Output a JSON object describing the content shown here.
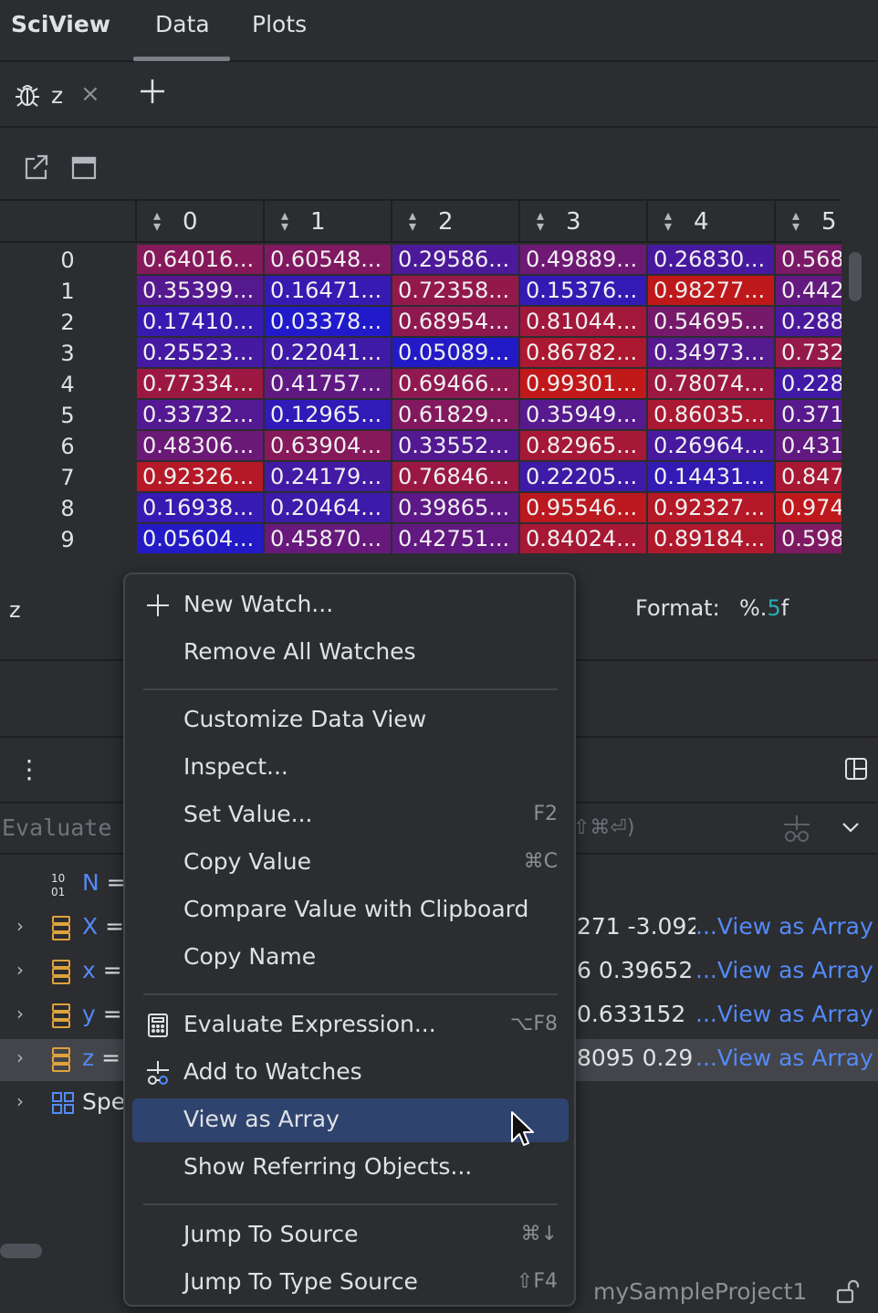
{
  "header": {
    "app_title": "SciView",
    "tabs": [
      {
        "label": "Data",
        "active": true
      },
      {
        "label": "Plots",
        "active": false
      }
    ]
  },
  "watch_tabs": {
    "current": "z"
  },
  "grid": {
    "columns": [
      "0",
      "1",
      "2",
      "3",
      "4",
      "5"
    ],
    "rows": [
      {
        "index": "0",
        "cells": [
          "0.64016...",
          "0.60548...",
          "0.29586...",
          "0.49889...",
          "0.26830...",
          "0.568"
        ]
      },
      {
        "index": "1",
        "cells": [
          "0.35399...",
          "0.16471...",
          "0.72358...",
          "0.15376...",
          "0.98277...",
          "0.442"
        ]
      },
      {
        "index": "2",
        "cells": [
          "0.17410...",
          "0.03378...",
          "0.68954...",
          "0.81044...",
          "0.54695...",
          "0.288"
        ]
      },
      {
        "index": "3",
        "cells": [
          "0.25523...",
          "0.22041...",
          "0.05089...",
          "0.86782...",
          "0.34973...",
          "0.732"
        ]
      },
      {
        "index": "4",
        "cells": [
          "0.77334...",
          "0.41757...",
          "0.69466...",
          "0.99301...",
          "0.78074...",
          "0.228"
        ]
      },
      {
        "index": "5",
        "cells": [
          "0.33732...",
          "0.12965...",
          "0.61829...",
          "0.35949...",
          "0.86035...",
          "0.371"
        ]
      },
      {
        "index": "6",
        "cells": [
          "0.48306...",
          "0.63904...",
          "0.33552...",
          "0.82965...",
          "0.26964...",
          "0.431"
        ]
      },
      {
        "index": "7",
        "cells": [
          "0.92326...",
          "0.24179...",
          "0.76846...",
          "0.22205...",
          "0.14431...",
          "0.847"
        ]
      },
      {
        "index": "8",
        "cells": [
          "0.16938...",
          "0.20464...",
          "0.39865...",
          "0.95546...",
          "0.92327...",
          "0.974"
        ]
      },
      {
        "index": "9",
        "cells": [
          "0.05604...",
          "0.45870...",
          "0.42751...",
          "0.84024...",
          "0.89184...",
          "0.598"
        ]
      }
    ],
    "heat_values": [
      [
        0.64016,
        0.60548,
        0.29586,
        0.49889,
        0.2683,
        0.568
      ],
      [
        0.35399,
        0.16471,
        0.72358,
        0.15376,
        0.98277,
        0.442
      ],
      [
        0.1741,
        0.03378,
        0.68954,
        0.81044,
        0.54695,
        0.288
      ],
      [
        0.25523,
        0.22041,
        0.05089,
        0.86782,
        0.34973,
        0.732
      ],
      [
        0.77334,
        0.41757,
        0.69466,
        0.99301,
        0.78074,
        0.228
      ],
      [
        0.33732,
        0.12965,
        0.61829,
        0.35949,
        0.86035,
        0.371
      ],
      [
        0.48306,
        0.63904,
        0.33552,
        0.82965,
        0.26964,
        0.431
      ],
      [
        0.92326,
        0.24179,
        0.76846,
        0.22205,
        0.14431,
        0.847
      ],
      [
        0.16938,
        0.20464,
        0.39865,
        0.95546,
        0.92327,
        0.974
      ],
      [
        0.05604,
        0.4587,
        0.42751,
        0.84024,
        0.89184,
        0.598
      ]
    ]
  },
  "format_bar": {
    "variable": "z",
    "label": "Format:",
    "value_prefix": "%.",
    "value_digit": "5",
    "value_suffix": "f"
  },
  "evaluate": {
    "placeholder": "Evaluate",
    "hint": "⇧⌘⏎)"
  },
  "variables": [
    {
      "name": "N",
      "eq": " =",
      "value": "",
      "link": "",
      "icon": "number-icon",
      "expandable": false
    },
    {
      "name": "X",
      "eq": " =",
      "value": "271 -3.092",
      "link": "...View as Array",
      "icon": "array-icon",
      "expandable": true
    },
    {
      "name": "x",
      "eq": " =",
      "value": "6 0.39652",
      "link": "...View as Array",
      "icon": "array-icon",
      "expandable": true
    },
    {
      "name": "y",
      "eq": " =",
      "value": "0.633152",
      "link": "...View as Array",
      "icon": "array-icon",
      "expandable": true
    },
    {
      "name": "z",
      "eq": " =",
      "value": "8095 0.29",
      "link": "...View as Array",
      "icon": "array-icon",
      "expandable": true,
      "selected": true
    },
    {
      "name": "Spe",
      "eq": "",
      "value": "",
      "link": "",
      "icon": "special-vars-icon",
      "expandable": true
    }
  ],
  "status": {
    "project": "mySampleProject1"
  },
  "context_menu": {
    "items": [
      {
        "label": "New Watch...",
        "shortcut": "",
        "icon": "plus-icon"
      },
      {
        "label": "Remove All Watches",
        "shortcut": ""
      },
      {
        "separator": true
      },
      {
        "label": "Customize Data View",
        "shortcut": ""
      },
      {
        "label": "Inspect...",
        "shortcut": ""
      },
      {
        "label": "Set Value...",
        "shortcut": "F2"
      },
      {
        "label": "Copy Value",
        "shortcut": "⌘C"
      },
      {
        "label": "Compare Value with Clipboard",
        "shortcut": ""
      },
      {
        "label": "Copy Name",
        "shortcut": ""
      },
      {
        "separator": true
      },
      {
        "label": "Evaluate Expression...",
        "shortcut": "⌥F8",
        "icon": "calculator-icon"
      },
      {
        "label": "Add to Watches",
        "shortcut": "",
        "icon": "glasses-icon"
      },
      {
        "label": "View as Array",
        "shortcut": "",
        "active": true
      },
      {
        "label": "Show Referring Objects...",
        "shortcut": ""
      },
      {
        "separator": true
      },
      {
        "label": "Jump To Source",
        "shortcut": "⌘↓"
      },
      {
        "label": "Jump To Type Source",
        "shortcut": "⇧F4"
      }
    ]
  },
  "colors": {
    "heat_low": "#1a1ad0",
    "heat_high": "#c21818",
    "accent_link": "#548af7",
    "menu_active": "#2e436e"
  }
}
